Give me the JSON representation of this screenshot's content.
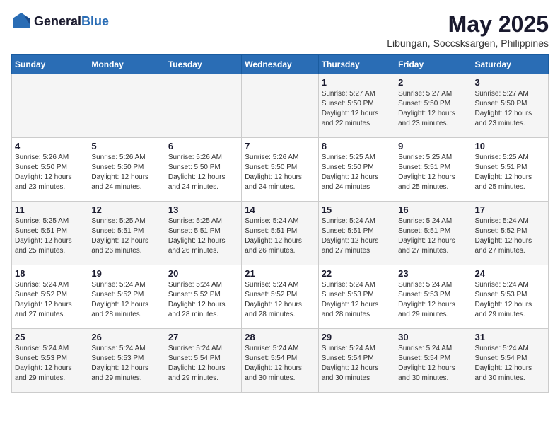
{
  "logo": {
    "general": "General",
    "blue": "Blue"
  },
  "title": {
    "month_year": "May 2025",
    "location": "Libungan, Soccsksargen, Philippines"
  },
  "weekdays": [
    "Sunday",
    "Monday",
    "Tuesday",
    "Wednesday",
    "Thursday",
    "Friday",
    "Saturday"
  ],
  "weeks": [
    [
      {
        "day": "",
        "info": ""
      },
      {
        "day": "",
        "info": ""
      },
      {
        "day": "",
        "info": ""
      },
      {
        "day": "",
        "info": ""
      },
      {
        "day": "1",
        "info": "Sunrise: 5:27 AM\nSunset: 5:50 PM\nDaylight: 12 hours\nand 22 minutes."
      },
      {
        "day": "2",
        "info": "Sunrise: 5:27 AM\nSunset: 5:50 PM\nDaylight: 12 hours\nand 23 minutes."
      },
      {
        "day": "3",
        "info": "Sunrise: 5:27 AM\nSunset: 5:50 PM\nDaylight: 12 hours\nand 23 minutes."
      }
    ],
    [
      {
        "day": "4",
        "info": "Sunrise: 5:26 AM\nSunset: 5:50 PM\nDaylight: 12 hours\nand 23 minutes."
      },
      {
        "day": "5",
        "info": "Sunrise: 5:26 AM\nSunset: 5:50 PM\nDaylight: 12 hours\nand 24 minutes."
      },
      {
        "day": "6",
        "info": "Sunrise: 5:26 AM\nSunset: 5:50 PM\nDaylight: 12 hours\nand 24 minutes."
      },
      {
        "day": "7",
        "info": "Sunrise: 5:26 AM\nSunset: 5:50 PM\nDaylight: 12 hours\nand 24 minutes."
      },
      {
        "day": "8",
        "info": "Sunrise: 5:25 AM\nSunset: 5:50 PM\nDaylight: 12 hours\nand 24 minutes."
      },
      {
        "day": "9",
        "info": "Sunrise: 5:25 AM\nSunset: 5:51 PM\nDaylight: 12 hours\nand 25 minutes."
      },
      {
        "day": "10",
        "info": "Sunrise: 5:25 AM\nSunset: 5:51 PM\nDaylight: 12 hours\nand 25 minutes."
      }
    ],
    [
      {
        "day": "11",
        "info": "Sunrise: 5:25 AM\nSunset: 5:51 PM\nDaylight: 12 hours\nand 25 minutes."
      },
      {
        "day": "12",
        "info": "Sunrise: 5:25 AM\nSunset: 5:51 PM\nDaylight: 12 hours\nand 26 minutes."
      },
      {
        "day": "13",
        "info": "Sunrise: 5:25 AM\nSunset: 5:51 PM\nDaylight: 12 hours\nand 26 minutes."
      },
      {
        "day": "14",
        "info": "Sunrise: 5:24 AM\nSunset: 5:51 PM\nDaylight: 12 hours\nand 26 minutes."
      },
      {
        "day": "15",
        "info": "Sunrise: 5:24 AM\nSunset: 5:51 PM\nDaylight: 12 hours\nand 27 minutes."
      },
      {
        "day": "16",
        "info": "Sunrise: 5:24 AM\nSunset: 5:51 PM\nDaylight: 12 hours\nand 27 minutes."
      },
      {
        "day": "17",
        "info": "Sunrise: 5:24 AM\nSunset: 5:52 PM\nDaylight: 12 hours\nand 27 minutes."
      }
    ],
    [
      {
        "day": "18",
        "info": "Sunrise: 5:24 AM\nSunset: 5:52 PM\nDaylight: 12 hours\nand 27 minutes."
      },
      {
        "day": "19",
        "info": "Sunrise: 5:24 AM\nSunset: 5:52 PM\nDaylight: 12 hours\nand 28 minutes."
      },
      {
        "day": "20",
        "info": "Sunrise: 5:24 AM\nSunset: 5:52 PM\nDaylight: 12 hours\nand 28 minutes."
      },
      {
        "day": "21",
        "info": "Sunrise: 5:24 AM\nSunset: 5:52 PM\nDaylight: 12 hours\nand 28 minutes."
      },
      {
        "day": "22",
        "info": "Sunrise: 5:24 AM\nSunset: 5:53 PM\nDaylight: 12 hours\nand 28 minutes."
      },
      {
        "day": "23",
        "info": "Sunrise: 5:24 AM\nSunset: 5:53 PM\nDaylight: 12 hours\nand 29 minutes."
      },
      {
        "day": "24",
        "info": "Sunrise: 5:24 AM\nSunset: 5:53 PM\nDaylight: 12 hours\nand 29 minutes."
      }
    ],
    [
      {
        "day": "25",
        "info": "Sunrise: 5:24 AM\nSunset: 5:53 PM\nDaylight: 12 hours\nand 29 minutes."
      },
      {
        "day": "26",
        "info": "Sunrise: 5:24 AM\nSunset: 5:53 PM\nDaylight: 12 hours\nand 29 minutes."
      },
      {
        "day": "27",
        "info": "Sunrise: 5:24 AM\nSunset: 5:54 PM\nDaylight: 12 hours\nand 29 minutes."
      },
      {
        "day": "28",
        "info": "Sunrise: 5:24 AM\nSunset: 5:54 PM\nDaylight: 12 hours\nand 30 minutes."
      },
      {
        "day": "29",
        "info": "Sunrise: 5:24 AM\nSunset: 5:54 PM\nDaylight: 12 hours\nand 30 minutes."
      },
      {
        "day": "30",
        "info": "Sunrise: 5:24 AM\nSunset: 5:54 PM\nDaylight: 12 hours\nand 30 minutes."
      },
      {
        "day": "31",
        "info": "Sunrise: 5:24 AM\nSunset: 5:54 PM\nDaylight: 12 hours\nand 30 minutes."
      }
    ]
  ],
  "colors": {
    "header_bg": "#2a6db5",
    "header_text": "#ffffff",
    "odd_row": "#f5f5f5",
    "even_row": "#ffffff"
  }
}
